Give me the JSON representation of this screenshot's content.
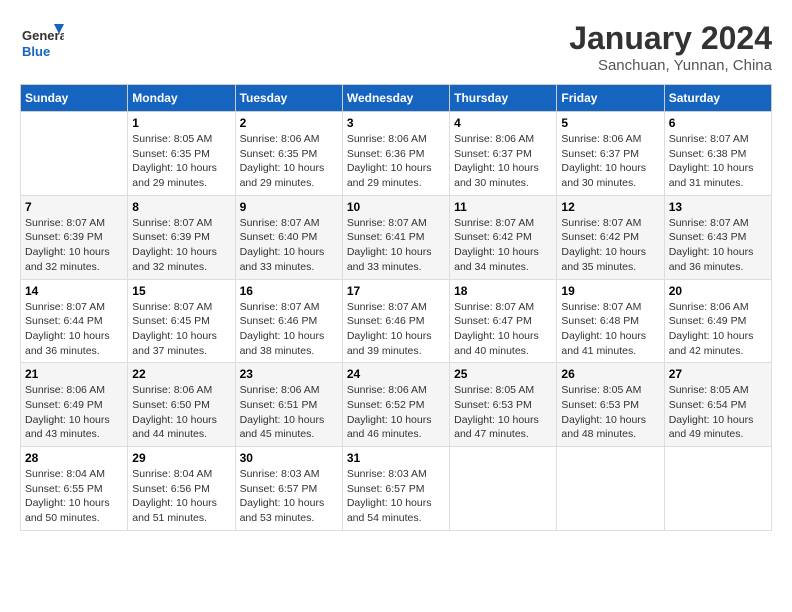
{
  "header": {
    "logo_line1": "General",
    "logo_line2": "Blue",
    "month": "January 2024",
    "location": "Sanchuan, Yunnan, China"
  },
  "weekdays": [
    "Sunday",
    "Monday",
    "Tuesday",
    "Wednesday",
    "Thursday",
    "Friday",
    "Saturday"
  ],
  "weeks": [
    [
      {
        "day": "",
        "info": ""
      },
      {
        "day": "1",
        "info": "Sunrise: 8:05 AM\nSunset: 6:35 PM\nDaylight: 10 hours\nand 29 minutes."
      },
      {
        "day": "2",
        "info": "Sunrise: 8:06 AM\nSunset: 6:35 PM\nDaylight: 10 hours\nand 29 minutes."
      },
      {
        "day": "3",
        "info": "Sunrise: 8:06 AM\nSunset: 6:36 PM\nDaylight: 10 hours\nand 29 minutes."
      },
      {
        "day": "4",
        "info": "Sunrise: 8:06 AM\nSunset: 6:37 PM\nDaylight: 10 hours\nand 30 minutes."
      },
      {
        "day": "5",
        "info": "Sunrise: 8:06 AM\nSunset: 6:37 PM\nDaylight: 10 hours\nand 30 minutes."
      },
      {
        "day": "6",
        "info": "Sunrise: 8:07 AM\nSunset: 6:38 PM\nDaylight: 10 hours\nand 31 minutes."
      }
    ],
    [
      {
        "day": "7",
        "info": "Sunrise: 8:07 AM\nSunset: 6:39 PM\nDaylight: 10 hours\nand 32 minutes."
      },
      {
        "day": "8",
        "info": "Sunrise: 8:07 AM\nSunset: 6:39 PM\nDaylight: 10 hours\nand 32 minutes."
      },
      {
        "day": "9",
        "info": "Sunrise: 8:07 AM\nSunset: 6:40 PM\nDaylight: 10 hours\nand 33 minutes."
      },
      {
        "day": "10",
        "info": "Sunrise: 8:07 AM\nSunset: 6:41 PM\nDaylight: 10 hours\nand 33 minutes."
      },
      {
        "day": "11",
        "info": "Sunrise: 8:07 AM\nSunset: 6:42 PM\nDaylight: 10 hours\nand 34 minutes."
      },
      {
        "day": "12",
        "info": "Sunrise: 8:07 AM\nSunset: 6:42 PM\nDaylight: 10 hours\nand 35 minutes."
      },
      {
        "day": "13",
        "info": "Sunrise: 8:07 AM\nSunset: 6:43 PM\nDaylight: 10 hours\nand 36 minutes."
      }
    ],
    [
      {
        "day": "14",
        "info": "Sunrise: 8:07 AM\nSunset: 6:44 PM\nDaylight: 10 hours\nand 36 minutes."
      },
      {
        "day": "15",
        "info": "Sunrise: 8:07 AM\nSunset: 6:45 PM\nDaylight: 10 hours\nand 37 minutes."
      },
      {
        "day": "16",
        "info": "Sunrise: 8:07 AM\nSunset: 6:46 PM\nDaylight: 10 hours\nand 38 minutes."
      },
      {
        "day": "17",
        "info": "Sunrise: 8:07 AM\nSunset: 6:46 PM\nDaylight: 10 hours\nand 39 minutes."
      },
      {
        "day": "18",
        "info": "Sunrise: 8:07 AM\nSunset: 6:47 PM\nDaylight: 10 hours\nand 40 minutes."
      },
      {
        "day": "19",
        "info": "Sunrise: 8:07 AM\nSunset: 6:48 PM\nDaylight: 10 hours\nand 41 minutes."
      },
      {
        "day": "20",
        "info": "Sunrise: 8:06 AM\nSunset: 6:49 PM\nDaylight: 10 hours\nand 42 minutes."
      }
    ],
    [
      {
        "day": "21",
        "info": "Sunrise: 8:06 AM\nSunset: 6:49 PM\nDaylight: 10 hours\nand 43 minutes."
      },
      {
        "day": "22",
        "info": "Sunrise: 8:06 AM\nSunset: 6:50 PM\nDaylight: 10 hours\nand 44 minutes."
      },
      {
        "day": "23",
        "info": "Sunrise: 8:06 AM\nSunset: 6:51 PM\nDaylight: 10 hours\nand 45 minutes."
      },
      {
        "day": "24",
        "info": "Sunrise: 8:06 AM\nSunset: 6:52 PM\nDaylight: 10 hours\nand 46 minutes."
      },
      {
        "day": "25",
        "info": "Sunrise: 8:05 AM\nSunset: 6:53 PM\nDaylight: 10 hours\nand 47 minutes."
      },
      {
        "day": "26",
        "info": "Sunrise: 8:05 AM\nSunset: 6:53 PM\nDaylight: 10 hours\nand 48 minutes."
      },
      {
        "day": "27",
        "info": "Sunrise: 8:05 AM\nSunset: 6:54 PM\nDaylight: 10 hours\nand 49 minutes."
      }
    ],
    [
      {
        "day": "28",
        "info": "Sunrise: 8:04 AM\nSunset: 6:55 PM\nDaylight: 10 hours\nand 50 minutes."
      },
      {
        "day": "29",
        "info": "Sunrise: 8:04 AM\nSunset: 6:56 PM\nDaylight: 10 hours\nand 51 minutes."
      },
      {
        "day": "30",
        "info": "Sunrise: 8:03 AM\nSunset: 6:57 PM\nDaylight: 10 hours\nand 53 minutes."
      },
      {
        "day": "31",
        "info": "Sunrise: 8:03 AM\nSunset: 6:57 PM\nDaylight: 10 hours\nand 54 minutes."
      },
      {
        "day": "",
        "info": ""
      },
      {
        "day": "",
        "info": ""
      },
      {
        "day": "",
        "info": ""
      }
    ]
  ]
}
